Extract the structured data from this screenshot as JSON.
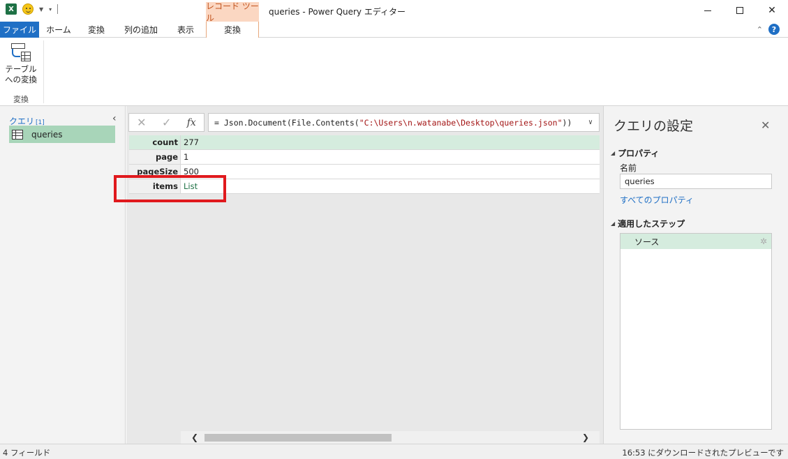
{
  "titlebar": {
    "app_icon_text": "X",
    "context_group": "レコード ツール",
    "window_title": "queries - Power Query エディター",
    "close_glyph": "✕"
  },
  "tabs": {
    "file": "ファイル",
    "home": "ホーム",
    "transform": "変換",
    "add_column": "列の追加",
    "view": "表示",
    "record_transform": "変換"
  },
  "ribbon": {
    "to_table_label_line1": "テーブル",
    "to_table_label_line2": "への変換",
    "group_label": "変換"
  },
  "query_pane": {
    "header": "クエリ",
    "count": "[1]",
    "items": [
      {
        "label": "queries"
      }
    ]
  },
  "formula_bar": {
    "cancel": "✕",
    "commit": "✓",
    "fx": "fx",
    "prefix": "= Json.Document(File.Contents(",
    "string": "\"C:\\Users\\n.watanabe\\Desktop\\queries.json\"",
    "suffix": "))"
  },
  "record": {
    "rows": [
      {
        "key": "count",
        "value": "277"
      },
      {
        "key": "page",
        "value": "1"
      },
      {
        "key": "pageSize",
        "value": "500"
      },
      {
        "key": "items",
        "value": "List"
      }
    ]
  },
  "settings": {
    "title": "クエリの設定",
    "properties_title": "プロパティ",
    "name_label": "名前",
    "name_value": "queries",
    "all_properties": "すべてのプロパティ",
    "applied_steps_title": "適用したステップ",
    "steps": [
      {
        "label": "ソース"
      }
    ]
  },
  "statusbar": {
    "left": "4 フィールド",
    "right": "16:53 にダウンロードされたプレビューです"
  },
  "colors": {
    "accent_blue": "#1f6fc5",
    "selection_green": "#a8d5b9",
    "highlight_red": "#e0191d",
    "context_tab": "#fbd7c2"
  }
}
